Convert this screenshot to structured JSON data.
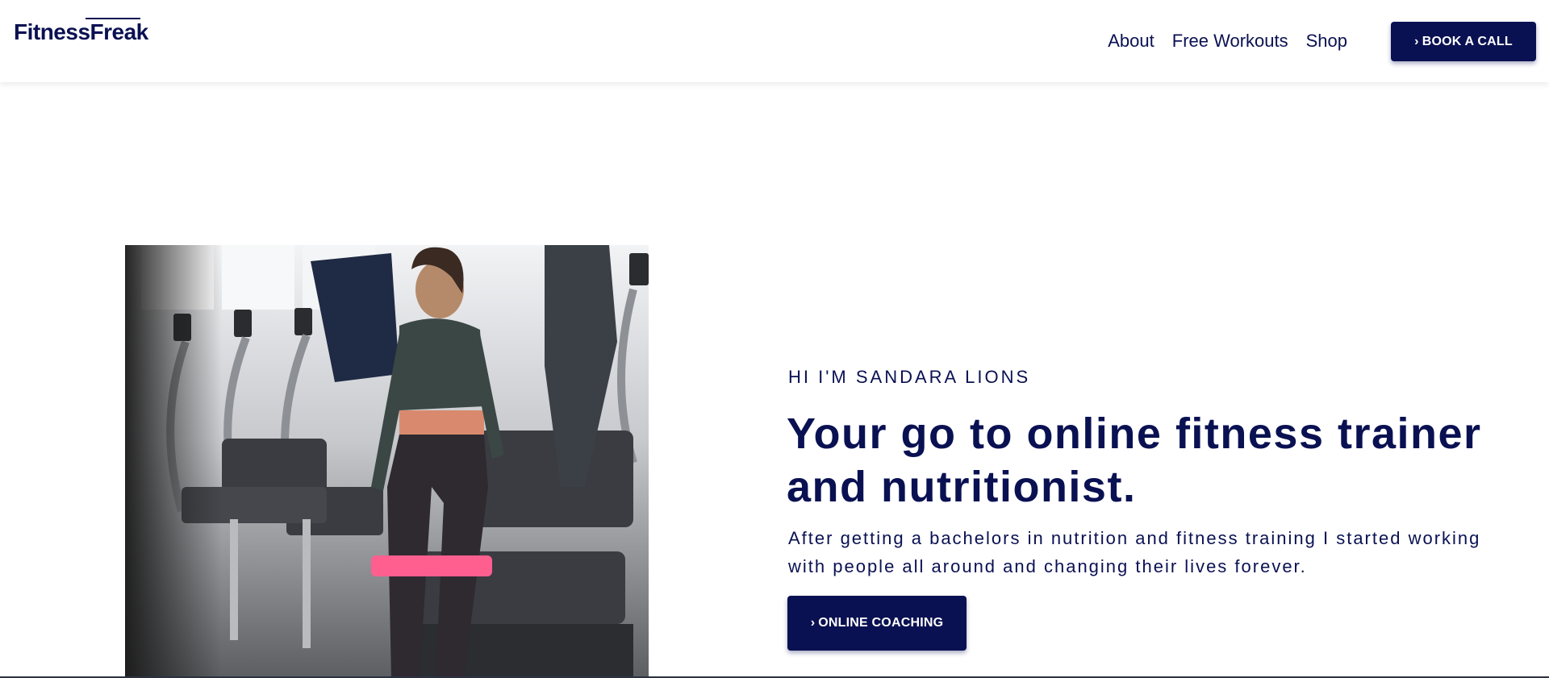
{
  "brand": {
    "logo_text": "FitnessFreak"
  },
  "nav": {
    "links": [
      {
        "label": "About"
      },
      {
        "label": "Free Workouts"
      },
      {
        "label": "Shop"
      }
    ],
    "cta_label": "BOOK A CALL",
    "cta_icon": "chevron-right-icon"
  },
  "hero": {
    "eyebrow": "HI I'M SANDARA LIONS",
    "headline_line1": "Your go to online fitness trainer",
    "headline_line2": "and nutritionist.",
    "description_line1": "After getting a bachelors in nutrition and fitness training I started working",
    "description_line2": "with people all around and changing their lives forever.",
    "cta_label": "ONLINE COACHING",
    "cta_icon": "chevron-right-icon"
  },
  "colors": {
    "primary": "#0a1152",
    "background": "#ffffff",
    "button_text": "#ffffff"
  }
}
